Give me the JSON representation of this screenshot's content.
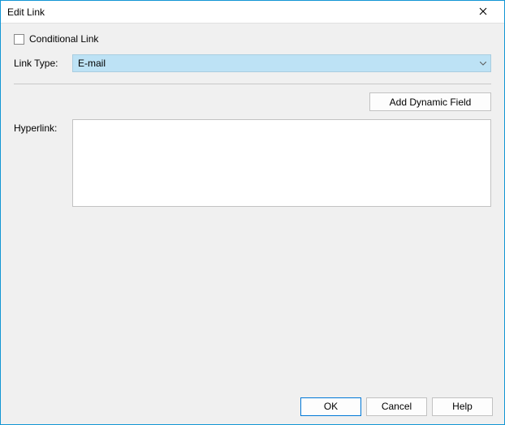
{
  "dialog": {
    "title": "Edit Link"
  },
  "form": {
    "conditional_label": "Conditional Link",
    "conditional_checked": false,
    "link_type_label": "Link Type:",
    "link_type_value": "E-mail",
    "add_dynamic_label": "Add Dynamic Field",
    "hyperlink_label": "Hyperlink:",
    "hyperlink_value": ""
  },
  "buttons": {
    "ok": "OK",
    "cancel": "Cancel",
    "help": "Help"
  }
}
